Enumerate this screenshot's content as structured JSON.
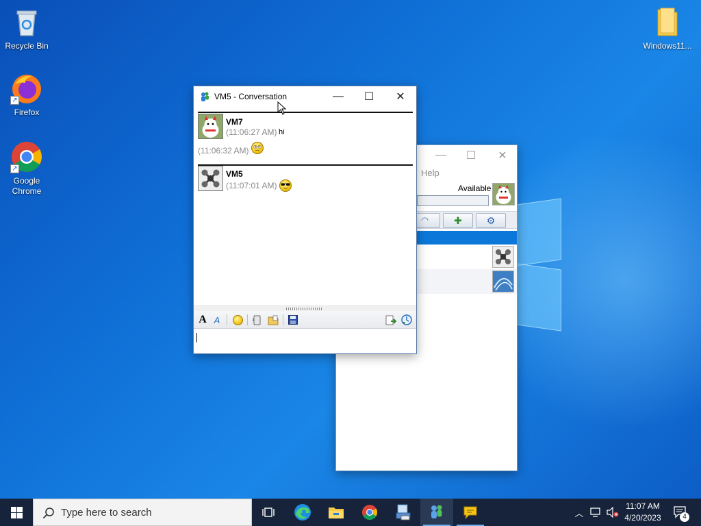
{
  "desktop": {
    "icons": [
      {
        "label": "Recycle Bin"
      },
      {
        "label": "Firefox"
      },
      {
        "label": "Google Chrome"
      },
      {
        "label": "Windows11..."
      }
    ]
  },
  "contact_window": {
    "menu_help": "Help",
    "status": "Available",
    "icon": "messenger-icon"
  },
  "conversation_window": {
    "title": "VM5 - Conversation",
    "messages": [
      {
        "sender": "VM7",
        "lines": [
          {
            "time": "(11:06:27 AM)",
            "text": "hi"
          },
          {
            "time": "(11:06:32 AM)",
            "emoticon": "confused-smiley-icon"
          }
        ]
      },
      {
        "sender": "VM5",
        "lines": [
          {
            "time": "(11:07:01 AM)",
            "emoticon": "sunglasses-smiley-icon"
          }
        ]
      }
    ],
    "format_toolbar": [
      "font-icon",
      "text-color-icon",
      "smiley-icon",
      "nudge-icon",
      "send-file-icon",
      "save-icon",
      "invite-icon",
      "history-icon"
    ],
    "input_value": ""
  },
  "taskbar": {
    "search_placeholder": "Type here to search",
    "apps": [
      "task-view-icon",
      "edge-icon",
      "file-explorer-icon",
      "chrome-icon",
      "network-app-icon",
      "messenger-icon",
      "chat-bubble-icon"
    ],
    "clock_time": "11:07 AM",
    "clock_date": "4/20/2023",
    "notification_count": "4"
  },
  "colors": {
    "desktop": "#0f6fd6",
    "taskbar": "#16233a",
    "selection": "#0b77d9"
  }
}
